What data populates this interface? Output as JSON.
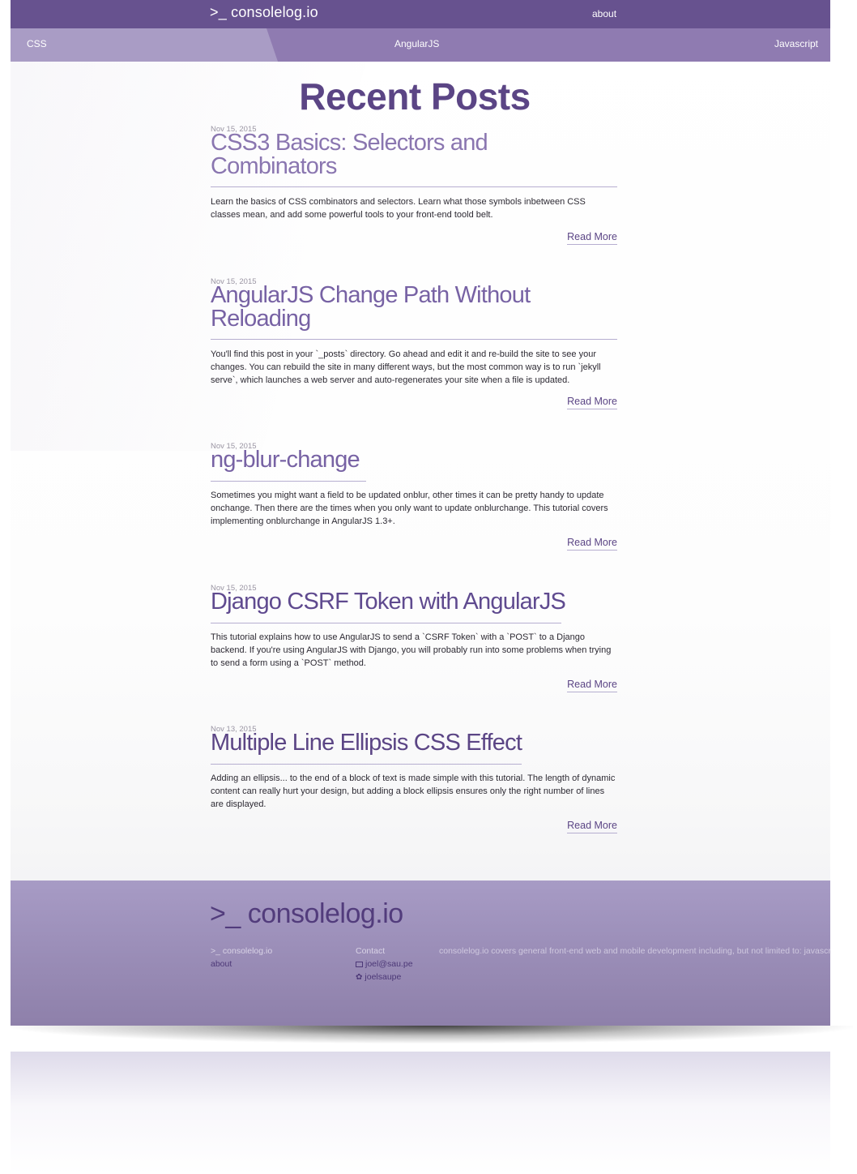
{
  "header": {
    "brand": ">_ consolelog.io",
    "about": "about"
  },
  "categories": {
    "css": "CSS",
    "angularjs": "AngularJS",
    "javascript": "Javascript"
  },
  "main": {
    "title": "Recent Posts",
    "posts": [
      {
        "date": "Nov 15, 2015",
        "title": "CSS3 Basics: Selectors and Combinators",
        "excerpt": "Learn the basics of CSS combinators and selectors. Learn what those symbols inbetween CSS classes mean, and add some powerful tools to your front-end toold belt.",
        "read_more": "Read More"
      },
      {
        "date": "Nov 15, 2015",
        "title": "AngularJS Change Path Without Reloading",
        "excerpt": "You'll find this post in your `_posts` directory. Go ahead and edit it and re-build the site to see your changes. You can rebuild the site in many different ways, but the most common way is to run `jekyll serve`, which launches a web server and auto-regenerates your site when a file is updated.",
        "read_more": "Read More"
      },
      {
        "date": "Nov 15, 2015",
        "title": "ng-blur-change",
        "excerpt": "Sometimes you might want a field to be updated onblur, other times it can be pretty handy to update onchange. Then there are the times when you only want to update onblurchange. This tutorial covers implementing onblurchange in AngularJS 1.3+.",
        "read_more": "Read More"
      },
      {
        "date": "Nov 15, 2015",
        "title": "Django CSRF Token with AngularJS",
        "excerpt": "This tutorial explains how to use AngularJS to send a `CSRF Token` with a `POST` to a Django backend. If you're using AngularJS with Django, you will probably run into some problems when trying to send a form using a `POST` method.",
        "read_more": "Read More"
      },
      {
        "date": "Nov 13, 2015",
        "title": "Multiple Line Ellipsis CSS Effect",
        "excerpt": "Adding an ellipsis... to the end of a block of text is made simple with this tutorial. The length of dynamic content can really hurt your design, but adding a block ellipsis ensures only the right number of lines are displayed.",
        "read_more": "Read More"
      }
    ]
  },
  "footer": {
    "logo": ">_ consolelog.io",
    "site_name": ">_ consolelog.io",
    "about": "about",
    "contact_label": "Contact",
    "email": "joel@sau.pe",
    "twitter": "joelsaupe",
    "description": "consolelog.io covers general front-end web and mobile development including, but not limited to: javascript, AngularJS, CSS, Sass, responsive design, and UI/UX design."
  },
  "colors": {
    "brand_purple": "#67528f",
    "nav_purple": "#8f7bb1",
    "title_purple": "#5b4585",
    "link_purple": "#6a539b"
  }
}
